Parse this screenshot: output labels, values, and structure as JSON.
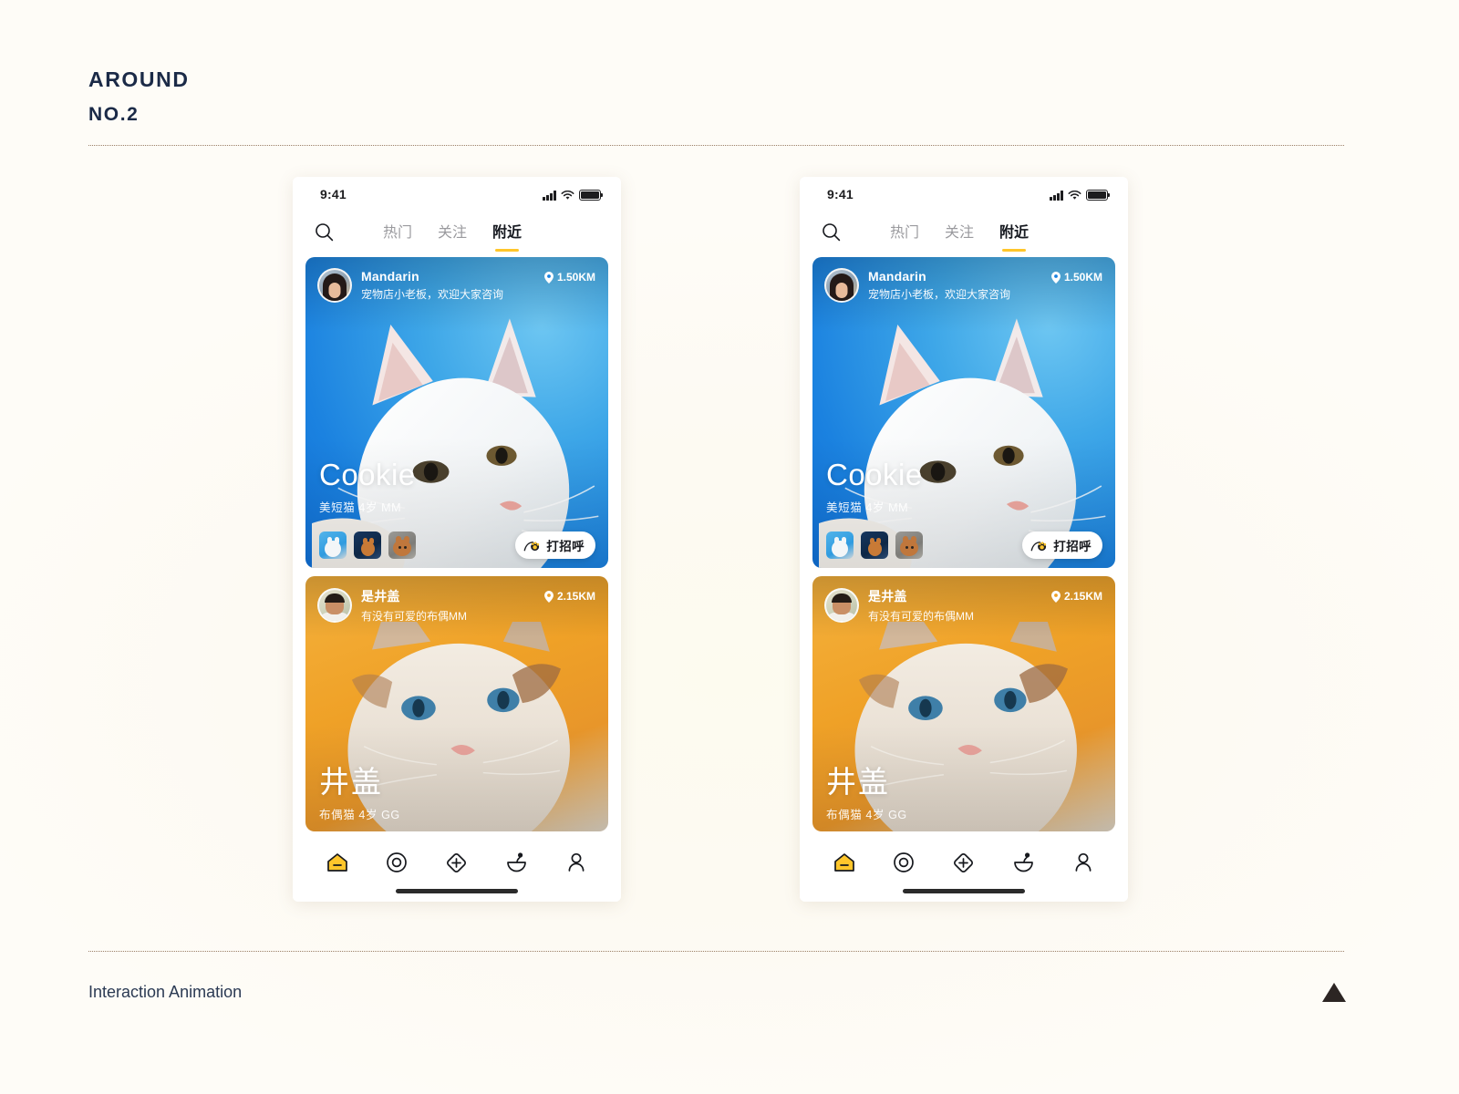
{
  "header": {
    "brand_line1": "AROUND",
    "brand_line2": "NO.2"
  },
  "footer": {
    "label": "Interaction Animation",
    "arrow_icon": "triangle-up-icon"
  },
  "phone": {
    "status_bar": {
      "time": "9:41",
      "signal_icon": "cellular-signal-icon",
      "wifi_icon": "wifi-icon",
      "battery_icon": "battery-full-icon"
    },
    "navbar": {
      "search_icon": "search-icon",
      "tabs": [
        {
          "label": "热门",
          "active": false
        },
        {
          "label": "关注",
          "active": false
        },
        {
          "label": "附近",
          "active": true
        }
      ]
    },
    "cards": [
      {
        "user_name": "Mandarin",
        "user_bio": "宠物店小老板，欢迎大家咨询",
        "distance": "1.50KM",
        "distance_icon": "location-pin-icon",
        "pet_name": "Cookie",
        "pet_meta": "美短猫  4岁  MM",
        "thumbnails": [
          "white-cat-thumb",
          "orange-cat-thumb",
          "tabby-cat-thumb"
        ],
        "action_label": "打招呼",
        "action_icon": "paw-wave-icon",
        "accent_color": "#1b82e0"
      },
      {
        "user_name": "是井盖",
        "user_bio": "有没有可爱的布偶MM",
        "distance": "2.15KM",
        "distance_icon": "location-pin-icon",
        "pet_name": "井盖",
        "pet_meta": "布偶猫  4岁  GG",
        "accent_color": "#efa127"
      }
    ],
    "tabbar": [
      {
        "icon": "home-icon",
        "active": true
      },
      {
        "icon": "discover-circle-icon",
        "active": false
      },
      {
        "icon": "add-plus-icon",
        "active": false
      },
      {
        "icon": "food-bowl-icon",
        "active": false
      },
      {
        "icon": "profile-person-icon",
        "active": false
      }
    ]
  },
  "colors": {
    "accent_yellow": "#ffc62b",
    "card_blue": "#1b82e0",
    "card_orange": "#efa127",
    "page_background": "#fdfaf3",
    "brand_navy": "#1b2a47"
  }
}
